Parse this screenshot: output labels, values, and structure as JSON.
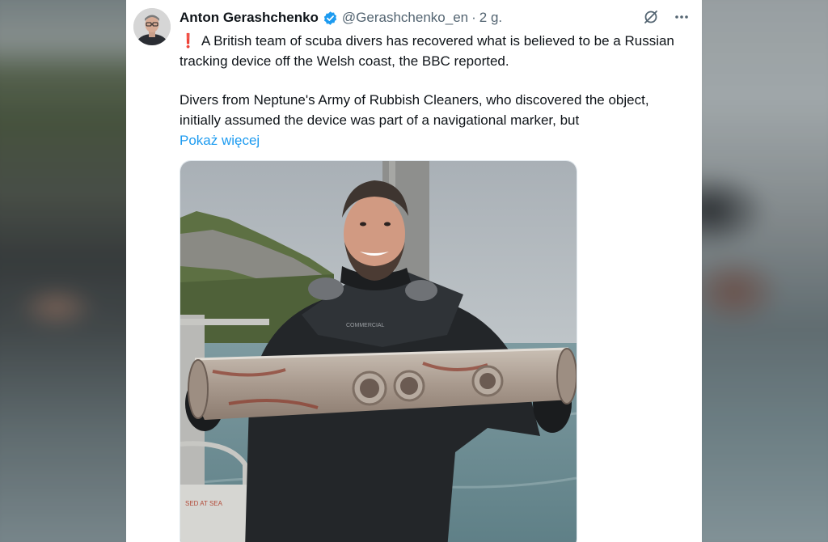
{
  "tweet": {
    "author_name": "Anton Gerashchenko",
    "handle": "@Gerashchenko_en",
    "separator": "·",
    "time": "2 g.",
    "text_line_1": "A British team of scuba divers has recovered what is believed to be a Russian tracking device off the Welsh coast, the BBC reported.",
    "text_line_2": "Divers from Neptune's Army of Rubbish Cleaners, who discovered the object, initially assumed the device was part of a navigational marker, but",
    "show_more": "Pokaż więcej",
    "exclaim_glyph": "❗"
  },
  "media": {
    "suit_text": "COMMERCIAL",
    "boat_text": "SED AT SEA"
  },
  "colors": {
    "link": "#1d9bf0",
    "verified": "#1d9bf0",
    "text": "#0f1419",
    "muted": "#536471"
  },
  "icons": {
    "verified": "verified-badge-icon",
    "grok": "grok-icon",
    "more": "more-options-icon"
  }
}
